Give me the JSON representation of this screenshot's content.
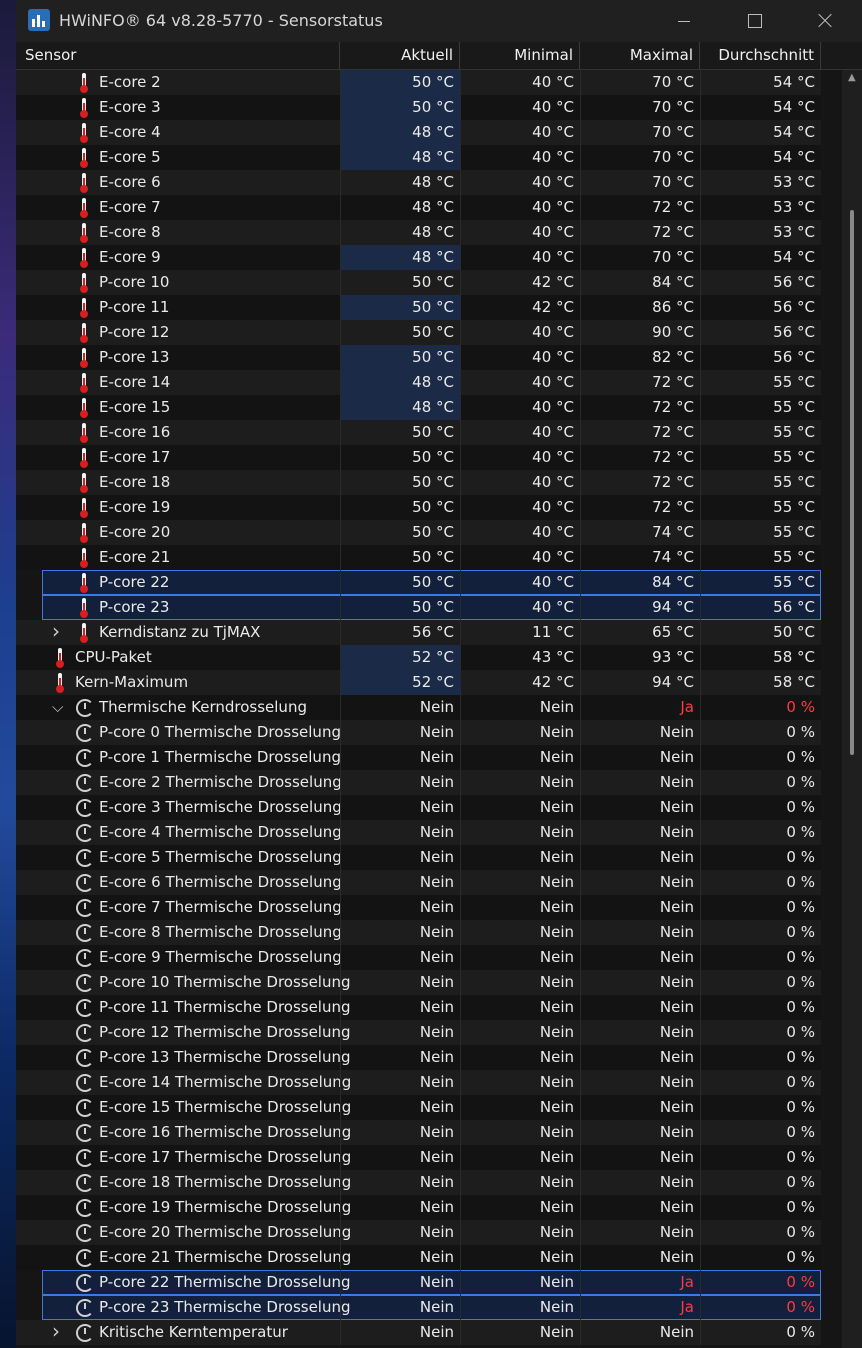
{
  "window": {
    "title": "HWiNFO® 64 v8.28-5770 - Sensorstatus",
    "app_icon": "hwinfo-logo-icon"
  },
  "columns": [
    "Sensor",
    "Aktuell",
    "Minimal",
    "Maximal",
    "Durchschnitt"
  ],
  "rows": [
    {
      "label": "E-core 2",
      "icon": "thermometer",
      "vals": [
        "50 °C",
        "40 °C",
        "70 °C",
        "54 °C"
      ]
    },
    {
      "label": "E-core 3",
      "icon": "thermometer",
      "vals": [
        "50 °C",
        "40 °C",
        "70 °C",
        "54 °C"
      ]
    },
    {
      "label": "E-core 4",
      "icon": "thermometer",
      "vals": [
        "48 °C",
        "40 °C",
        "70 °C",
        "54 °C"
      ]
    },
    {
      "label": "E-core 5",
      "icon": "thermometer",
      "vals": [
        "48 °C",
        "40 °C",
        "70 °C",
        "54 °C"
      ]
    },
    {
      "label": "E-core 6",
      "icon": "thermometer",
      "vals": [
        "48 °C",
        "40 °C",
        "70 °C",
        "53 °C"
      ]
    },
    {
      "label": "E-core 7",
      "icon": "thermometer",
      "vals": [
        "48 °C",
        "40 °C",
        "72 °C",
        "53 °C"
      ]
    },
    {
      "label": "E-core 8",
      "icon": "thermometer",
      "vals": [
        "48 °C",
        "40 °C",
        "72 °C",
        "53 °C"
      ]
    },
    {
      "label": "E-core 9",
      "icon": "thermometer",
      "vals": [
        "48 °C",
        "40 °C",
        "70 °C",
        "54 °C"
      ]
    },
    {
      "label": "P-core 10",
      "icon": "thermometer",
      "vals": [
        "50 °C",
        "42 °C",
        "84 °C",
        "56 °C"
      ]
    },
    {
      "label": "P-core 11",
      "icon": "thermometer",
      "vals": [
        "50 °C",
        "42 °C",
        "86 °C",
        "56 °C"
      ]
    },
    {
      "label": "P-core 12",
      "icon": "thermometer",
      "vals": [
        "50 °C",
        "40 °C",
        "90 °C",
        "56 °C"
      ]
    },
    {
      "label": "P-core 13",
      "icon": "thermometer",
      "vals": [
        "50 °C",
        "40 °C",
        "82 °C",
        "56 °C"
      ]
    },
    {
      "label": "E-core 14",
      "icon": "thermometer",
      "vals": [
        "48 °C",
        "40 °C",
        "72 °C",
        "55 °C"
      ]
    },
    {
      "label": "E-core 15",
      "icon": "thermometer",
      "vals": [
        "48 °C",
        "40 °C",
        "72 °C",
        "55 °C"
      ]
    },
    {
      "label": "E-core 16",
      "icon": "thermometer",
      "vals": [
        "50 °C",
        "40 °C",
        "72 °C",
        "55 °C"
      ]
    },
    {
      "label": "E-core 17",
      "icon": "thermometer",
      "vals": [
        "50 °C",
        "40 °C",
        "72 °C",
        "55 °C"
      ]
    },
    {
      "label": "E-core 18",
      "icon": "thermometer",
      "vals": [
        "50 °C",
        "40 °C",
        "72 °C",
        "55 °C"
      ]
    },
    {
      "label": "E-core 19",
      "icon": "thermometer",
      "vals": [
        "50 °C",
        "40 °C",
        "72 °C",
        "55 °C"
      ]
    },
    {
      "label": "E-core 20",
      "icon": "thermometer",
      "vals": [
        "50 °C",
        "40 °C",
        "74 °C",
        "55 °C"
      ]
    },
    {
      "label": "E-core 21",
      "icon": "thermometer",
      "vals": [
        "50 °C",
        "40 °C",
        "74 °C",
        "55 °C"
      ]
    },
    {
      "label": "P-core 22",
      "icon": "thermometer",
      "vals": [
        "50 °C",
        "40 °C",
        "84 °C",
        "55 °C"
      ],
      "selected": true
    },
    {
      "label": "P-core 23",
      "icon": "thermometer",
      "vals": [
        "50 °C",
        "40 °C",
        "94 °C",
        "56 °C"
      ],
      "selected": true
    },
    {
      "label": "Kerndistanz zu TjMAX",
      "icon": "thermometer",
      "expander": "collapsed",
      "vals": [
        "56 °C",
        "11 °C",
        "65 °C",
        "50 °C"
      ]
    },
    {
      "label": "CPU-Paket",
      "icon": "thermometer",
      "level": "top",
      "vals": [
        "52 °C",
        "43 °C",
        "93 °C",
        "58 °C"
      ]
    },
    {
      "label": "Kern-Maximum",
      "icon": "thermometer",
      "level": "top",
      "vals": [
        "52 °C",
        "42 °C",
        "94 °C",
        "58 °C"
      ]
    },
    {
      "label": "Thermische Kerndrosselung",
      "icon": "clock",
      "expander": "expanded",
      "vals": [
        "Nein",
        "Nein",
        "Ja",
        "0 %"
      ],
      "red": [
        2,
        3
      ]
    },
    {
      "label": "P-core 0 Thermische Drosselung",
      "icon": "clock",
      "vals": [
        "Nein",
        "Nein",
        "Nein",
        "0 %"
      ]
    },
    {
      "label": "P-core 1 Thermische Drosselung",
      "icon": "clock",
      "vals": [
        "Nein",
        "Nein",
        "Nein",
        "0 %"
      ]
    },
    {
      "label": "E-core 2 Thermische Drosselung",
      "icon": "clock",
      "vals": [
        "Nein",
        "Nein",
        "Nein",
        "0 %"
      ]
    },
    {
      "label": "E-core 3 Thermische Drosselung",
      "icon": "clock",
      "vals": [
        "Nein",
        "Nein",
        "Nein",
        "0 %"
      ]
    },
    {
      "label": "E-core 4 Thermische Drosselung",
      "icon": "clock",
      "vals": [
        "Nein",
        "Nein",
        "Nein",
        "0 %"
      ]
    },
    {
      "label": "E-core 5 Thermische Drosselung",
      "icon": "clock",
      "vals": [
        "Nein",
        "Nein",
        "Nein",
        "0 %"
      ]
    },
    {
      "label": "E-core 6 Thermische Drosselung",
      "icon": "clock",
      "vals": [
        "Nein",
        "Nein",
        "Nein",
        "0 %"
      ]
    },
    {
      "label": "E-core 7 Thermische Drosselung",
      "icon": "clock",
      "vals": [
        "Nein",
        "Nein",
        "Nein",
        "0 %"
      ]
    },
    {
      "label": "E-core 8 Thermische Drosselung",
      "icon": "clock",
      "vals": [
        "Nein",
        "Nein",
        "Nein",
        "0 %"
      ]
    },
    {
      "label": "E-core 9 Thermische Drosselung",
      "icon": "clock",
      "vals": [
        "Nein",
        "Nein",
        "Nein",
        "0 %"
      ]
    },
    {
      "label": "P-core 10 Thermische Drosselung",
      "icon": "clock",
      "vals": [
        "Nein",
        "Nein",
        "Nein",
        "0 %"
      ]
    },
    {
      "label": "P-core 11 Thermische Drosselung",
      "icon": "clock",
      "vals": [
        "Nein",
        "Nein",
        "Nein",
        "0 %"
      ]
    },
    {
      "label": "P-core 12 Thermische Drosselung",
      "icon": "clock",
      "vals": [
        "Nein",
        "Nein",
        "Nein",
        "0 %"
      ]
    },
    {
      "label": "P-core 13 Thermische Drosselung",
      "icon": "clock",
      "vals": [
        "Nein",
        "Nein",
        "Nein",
        "0 %"
      ]
    },
    {
      "label": "E-core 14 Thermische Drosselung",
      "icon": "clock",
      "vals": [
        "Nein",
        "Nein",
        "Nein",
        "0 %"
      ]
    },
    {
      "label": "E-core 15 Thermische Drosselung",
      "icon": "clock",
      "vals": [
        "Nein",
        "Nein",
        "Nein",
        "0 %"
      ]
    },
    {
      "label": "E-core 16 Thermische Drosselung",
      "icon": "clock",
      "vals": [
        "Nein",
        "Nein",
        "Nein",
        "0 %"
      ]
    },
    {
      "label": "E-core 17 Thermische Drosselung",
      "icon": "clock",
      "vals": [
        "Nein",
        "Nein",
        "Nein",
        "0 %"
      ]
    },
    {
      "label": "E-core 18 Thermische Drosselung",
      "icon": "clock",
      "vals": [
        "Nein",
        "Nein",
        "Nein",
        "0 %"
      ]
    },
    {
      "label": "E-core 19 Thermische Drosselung",
      "icon": "clock",
      "vals": [
        "Nein",
        "Nein",
        "Nein",
        "0 %"
      ]
    },
    {
      "label": "E-core 20 Thermische Drosselung",
      "icon": "clock",
      "vals": [
        "Nein",
        "Nein",
        "Nein",
        "0 %"
      ]
    },
    {
      "label": "E-core 21 Thermische Drosselung",
      "icon": "clock",
      "vals": [
        "Nein",
        "Nein",
        "Nein",
        "0 %"
      ]
    },
    {
      "label": "P-core 22 Thermische Drosselung",
      "icon": "clock",
      "vals": [
        "Nein",
        "Nein",
        "Ja",
        "0 %"
      ],
      "red": [
        2,
        3
      ],
      "selected": true
    },
    {
      "label": "P-core 23 Thermische Drosselung",
      "icon": "clock",
      "vals": [
        "Nein",
        "Nein",
        "Ja",
        "0 %"
      ],
      "red": [
        2,
        3
      ],
      "selected": true
    },
    {
      "label": "Kritische Kerntemperatur",
      "icon": "clock",
      "expander": "collapsed",
      "vals": [
        "Nein",
        "Nein",
        "Nein",
        "0 %"
      ]
    }
  ],
  "highlighted_cells": [
    0,
    1,
    2,
    3,
    7,
    9,
    11,
    12,
    13,
    23,
    24
  ],
  "colors": {
    "alert_red": "#ff3b3b",
    "selection_border": "#3a7be0",
    "value_highlight": "#1a2a47"
  }
}
